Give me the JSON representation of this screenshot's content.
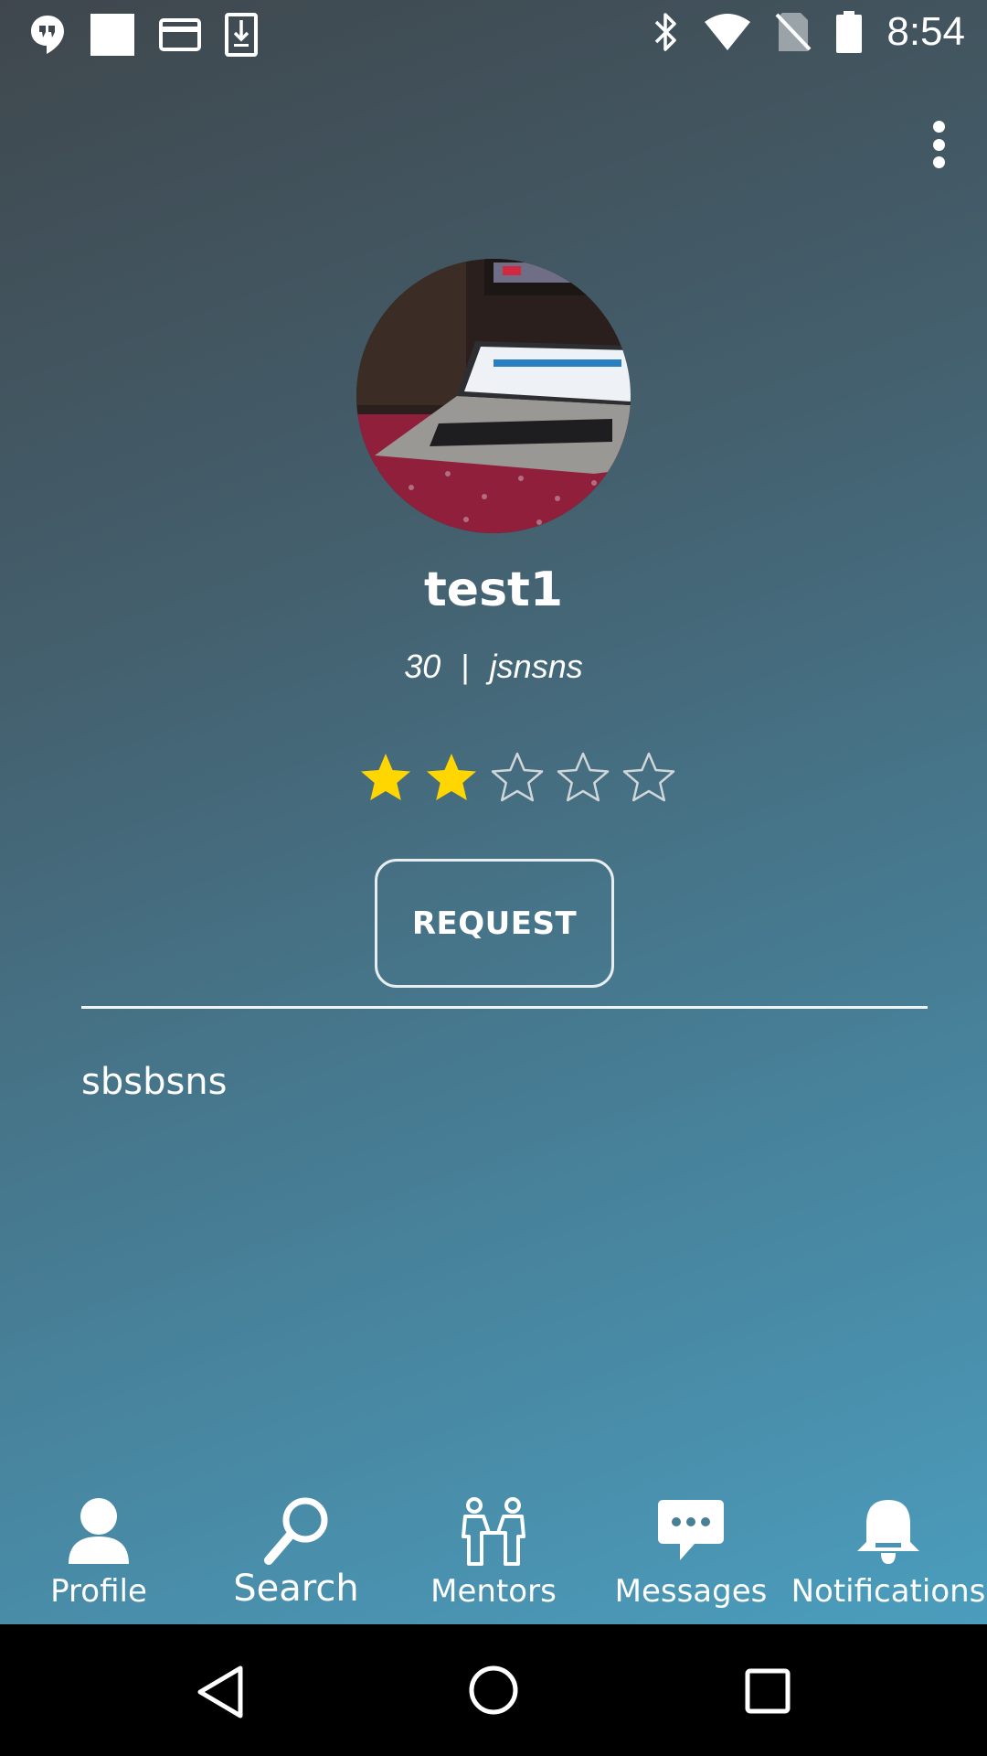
{
  "status_bar": {
    "time": "8:54",
    "left_icons": [
      "hangouts-icon",
      "square-icon",
      "card-icon",
      "download-icon"
    ],
    "right_icons": [
      "bluetooth-icon",
      "wifi-icon",
      "no-sim-icon",
      "battery-icon"
    ]
  },
  "profile": {
    "name": "test1",
    "age": "30",
    "separator": "|",
    "detail": "jsnsns",
    "rating": 2,
    "rating_max": 5,
    "request_label": "REQUEST",
    "bio": "sbsbsns"
  },
  "bottom_nav": {
    "items": [
      {
        "label": "Profile",
        "icon": "person-icon"
      },
      {
        "label": "Search",
        "icon": "search-icon"
      },
      {
        "label": "Mentors",
        "icon": "mentors-icon"
      },
      {
        "label": "Messages",
        "icon": "chat-bubble-icon"
      },
      {
        "label": "Notifications",
        "icon": "bell-icon"
      }
    ],
    "active_index": 1
  },
  "colors": {
    "star_filled": "#ffd600",
    "star_outline": "#d0d6d9"
  }
}
